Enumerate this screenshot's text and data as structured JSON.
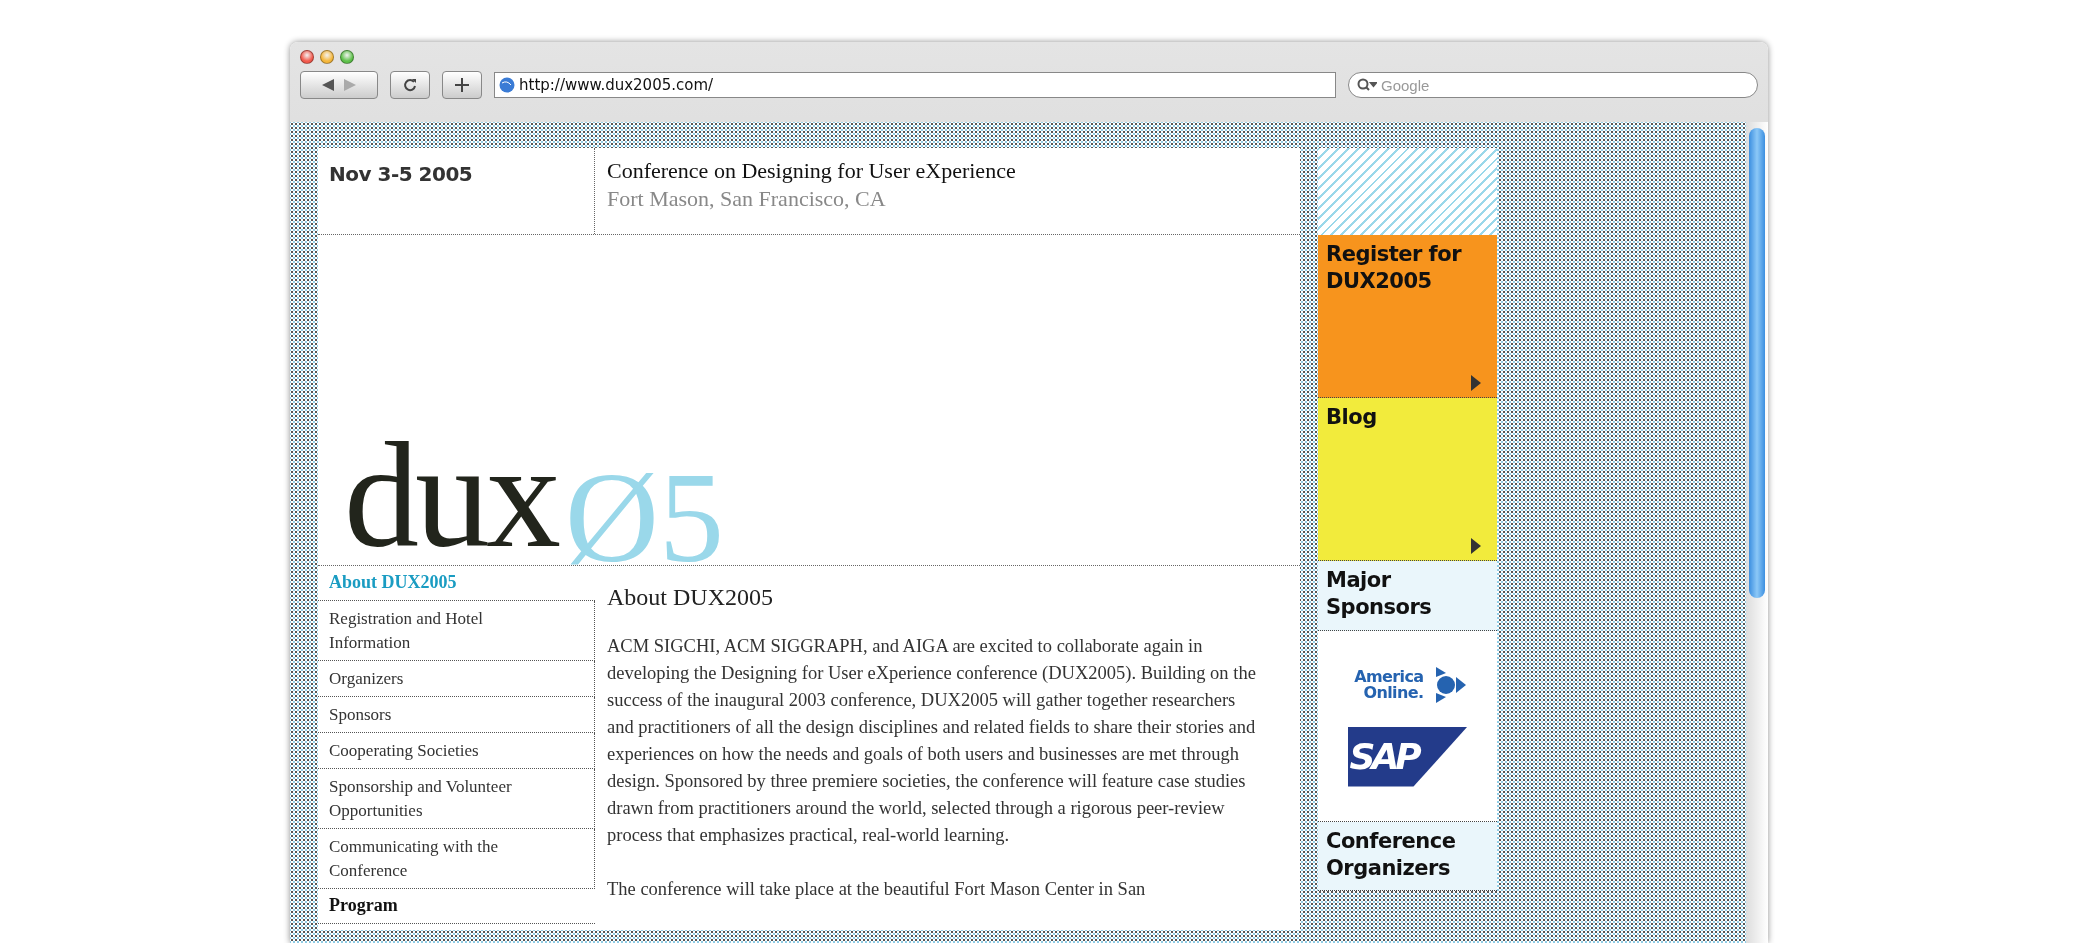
{
  "browser": {
    "url": "http://www.dux2005.com/",
    "search": {
      "placeholder": "Google"
    }
  },
  "header": {
    "date": "Nov 3-5 2005",
    "title": "Conference on Designing for User eXperience",
    "location": "Fort Mason, San Francisco, CA"
  },
  "logo": {
    "word": "dux",
    "year": "Ø5"
  },
  "nav": [
    {
      "label": "About DUX2005",
      "kind": "section",
      "selected": true
    },
    {
      "label": "Registration and Hotel Information",
      "kind": "item",
      "selected": false
    },
    {
      "label": "Organizers",
      "kind": "item",
      "selected": false
    },
    {
      "label": "Sponsors",
      "kind": "item",
      "selected": false
    },
    {
      "label": "Cooperating Societies",
      "kind": "item",
      "selected": false
    },
    {
      "label": "Sponsorship and Volunteer Opportunities",
      "kind": "item",
      "selected": false
    },
    {
      "label": "Communicating with the Conference",
      "kind": "item",
      "selected": false
    },
    {
      "label": "Program",
      "kind": "section",
      "selected": false
    }
  ],
  "article": {
    "title": "About DUX2005",
    "paragraphs": [
      "ACM SIGCHI, ACM SIGGRAPH, and AIGA are excited to collaborate again in developing the Designing for User eXperience conference (DUX2005). Building on the success of the inaugural 2003 conference, DUX2005 will gather together researchers and practitioners of all the design disciplines and related fields to share their stories and experiences on how the needs and goals of both users and businesses are met through design. Sponsored by three premiere societies, the conference will feature case studies drawn from practitioners around the world, selected through a rigorous peer-review process that emphasizes practical, real-world learning.",
      "The conference will take place at the beautiful Fort Mason Center in San"
    ]
  },
  "sidebar": [
    {
      "kind": "action",
      "label": "Register for DUX2005",
      "color": "#f7941d"
    },
    {
      "kind": "action",
      "label": "Blog",
      "color": "#f2eb3c"
    },
    {
      "kind": "heading",
      "label": "Major Sponsors"
    },
    {
      "kind": "sponsors",
      "sponsors": [
        {
          "kind": "aol",
          "name": "America Online."
        },
        {
          "kind": "sap",
          "name": "SAP"
        }
      ]
    },
    {
      "kind": "heading",
      "label": "Conference Organizers"
    }
  ]
}
